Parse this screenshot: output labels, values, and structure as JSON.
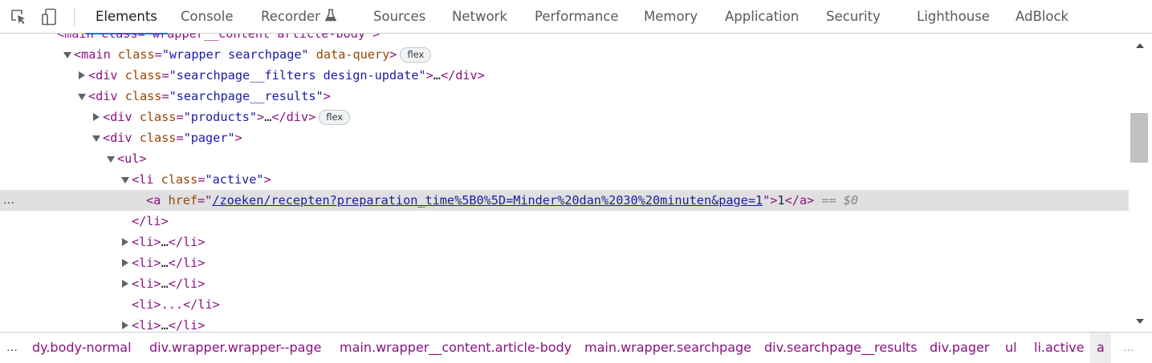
{
  "toolbar": {
    "icons": [
      "inspect-element-icon",
      "device-toolbar-icon"
    ],
    "tabs": [
      "Elements",
      "Console",
      "Recorder",
      "Sources",
      "Network",
      "Performance",
      "Memory",
      "Application",
      "Security",
      "Lighthouse",
      "AdBlock"
    ],
    "active_tab": "Elements",
    "accent_color": "#1a73e8"
  },
  "tree": {
    "rows": [
      {
        "r0_t1": "<main class=\"wrapper__content article-body\">"
      },
      {
        "r1_t1": "<main",
        "r1_a1": "class",
        "r1_v1": "\"wrapper searchpage\"",
        "r1_a2": "data-query",
        "r1_t2": ">",
        "r1_badge": "flex"
      },
      {
        "r2_t1": "<div",
        "r2_a1": "class",
        "r2_v1": "\"searchpage__filters design-update\"",
        "r2_t2": ">",
        "r2_x1": "…",
        "r2_t3": "</div>"
      },
      {
        "r3_t1": "<div",
        "r3_a1": "class",
        "r3_v1": "\"searchpage__results\"",
        "r3_t2": ">"
      },
      {
        "r4_t1": "<div",
        "r4_a1": "class",
        "r4_v1": "\"products\"",
        "r4_t2": ">",
        "r4_x1": "…",
        "r4_t3": "</div>",
        "r4_badge": "flex"
      },
      {
        "r5_t1": "<div",
        "r5_a1": "class",
        "r5_v1": "\"pager\"",
        "r5_t2": ">"
      },
      {
        "r6_t1": "<ul>"
      },
      {
        "r7_t1": "<li",
        "r7_a1": "class",
        "r7_v1": "\"active\"",
        "r7_t2": ">"
      },
      {
        "r8_t1": "<a",
        "r8_a1": "href",
        "r8_v1": "/zoeken/recepten?preparation_time%5B0%5D=Minder%20dan%2030%20minuten&page=1",
        "r8_t2": ">",
        "r8_x1": "1",
        "r8_t3": "</a>",
        "r8_eq": "== $0",
        "dots": "…"
      },
      {
        "r9_t1": "</li>"
      },
      {
        "r10_t1": "<li>",
        "r10_x1": "…",
        "r10_t2": "</li>"
      },
      {
        "r11_t1": "<li>",
        "r11_x1": "…",
        "r11_t2": "</li>"
      },
      {
        "r12_t1": "<li>",
        "r12_x1": "…",
        "r12_t2": "</li>"
      },
      {
        "r13_t1": "<li>",
        "r13_x1": "...",
        "r13_t2": "</li>"
      },
      {
        "r14_t1": "<li>",
        "r14_x1": "…",
        "r14_t2": "</li>"
      }
    ],
    "colors": {
      "tag": "#881280",
      "attr_name": "#994500",
      "attr_value": "#1a1aa6",
      "selected_row": "#e0e0e0"
    }
  },
  "breadcrumbs": {
    "left_dots": "…",
    "right_dots": "…",
    "items": [
      "dy.body-normal",
      "div.wrapper.wrapper--page",
      "main.wrapper__content.article-body",
      "main.wrapper.searchpage",
      "div.searchpage__results",
      "div.pager",
      "ul",
      "li.active",
      "a"
    ],
    "active_item": "a"
  }
}
